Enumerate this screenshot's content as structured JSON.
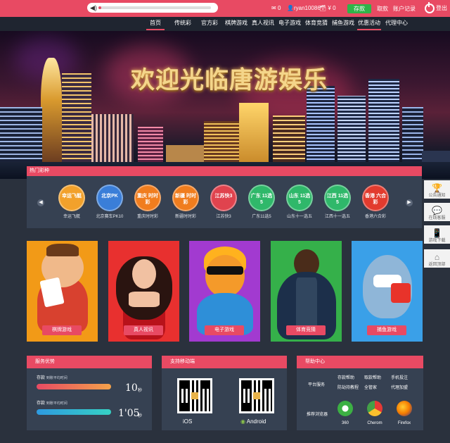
{
  "topbar": {
    "messages": "0",
    "username": "ryan10086",
    "balance": "¥ 0",
    "deposit": "存款",
    "withdraw": "取款",
    "account": "账户记录",
    "logout": "登出"
  },
  "nav": [
    "首页",
    "传统彩",
    "官方彩",
    "棋牌游戏",
    "真人视讯",
    "电子游戏",
    "体育竞猜",
    "捕鱼游戏",
    "优惠活动",
    "代理中心"
  ],
  "banner": {
    "title": "欢迎光临唐游娱乐"
  },
  "hot": {
    "title": "热门彩种",
    "items": [
      {
        "badge": "幸运飞艇",
        "name": "幸运飞艇",
        "color": "#f2a12b"
      },
      {
        "badge": "北京PK",
        "name": "北京赛车PK10",
        "color": "#3a7ed8"
      },
      {
        "badge": "重庆 时时彩",
        "name": "重庆时时彩",
        "color": "#f07d1e"
      },
      {
        "badge": "新疆 时时彩",
        "name": "新疆时时彩",
        "color": "#f07d1e"
      },
      {
        "badge": "江苏快3",
        "name": "江苏快3",
        "color": "#e0434e"
      },
      {
        "badge": "广东 11选5",
        "name": "广东11选5",
        "color": "#2fb86a"
      },
      {
        "badge": "山东 11选5",
        "name": "山东十一选五",
        "color": "#2fb86a"
      },
      {
        "badge": "江西 11选5",
        "name": "江西十一选五",
        "color": "#2fb86a"
      },
      {
        "badge": "香港 六合彩",
        "name": "香港六合彩",
        "color": "#e23b2e"
      }
    ]
  },
  "side": [
    "公告通知",
    "在线客服",
    "游戏下载",
    "返回顶部"
  ],
  "games": [
    {
      "label": "棋牌游戏",
      "bg": "#f29a17"
    },
    {
      "label": "真人视讯",
      "bg": "#e8302f"
    },
    {
      "label": "电子游戏",
      "bg": "#a23ad0"
    },
    {
      "label": "体育竞猜",
      "bg": "#35b04a"
    },
    {
      "label": "捕鱼游戏",
      "bg": "#3aa0e8"
    }
  ],
  "service": {
    "title": "服务优势",
    "deposit_label": "存款",
    "deposit_sub": "到账平均时间",
    "deposit_time": "10",
    "deposit_unit": "秒",
    "withdraw_label": "存款",
    "withdraw_sub": "到账平均时间",
    "withdraw_time": "1'05",
    "withdraw_unit": "秒"
  },
  "mobile": {
    "title": "支持移动端",
    "ios": "iOS",
    "android": "Android"
  },
  "help": {
    "title": "帮助中心",
    "platform_label": "平台服务",
    "links": [
      "存款帮助",
      "取款帮助",
      "手机投注",
      "防劫持教程",
      "全管家",
      "代理加盟"
    ],
    "browser_label": "推荐浏览器",
    "browsers": [
      "360",
      "Cherom",
      "Firefox"
    ]
  }
}
